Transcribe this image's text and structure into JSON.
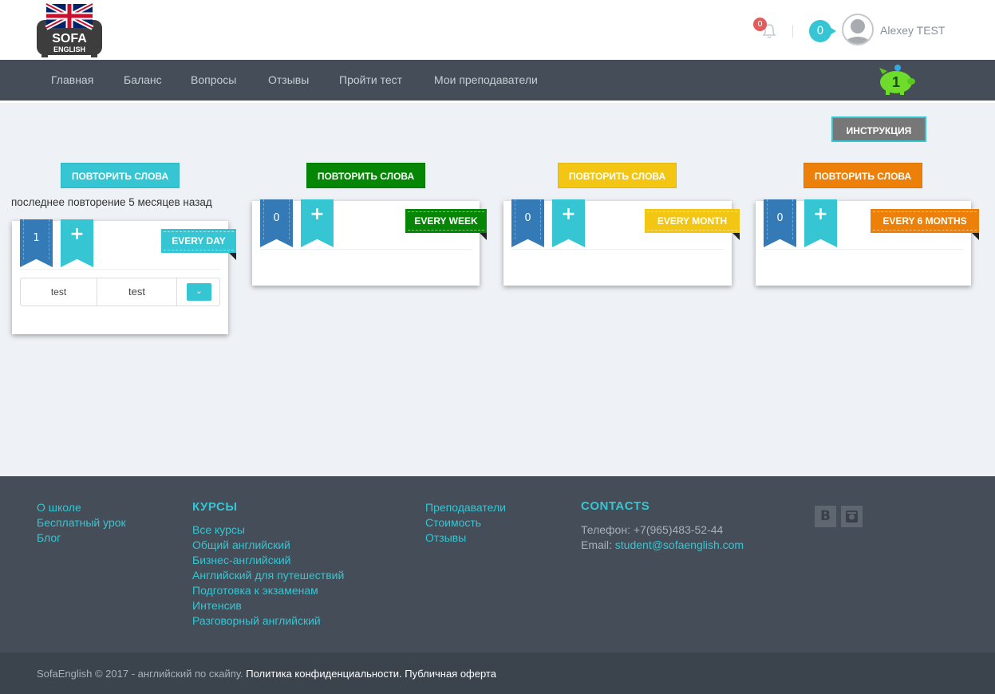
{
  "header": {
    "logo_text_top": "SOFA",
    "logo_text_bottom": "ENGLISH",
    "notifications_count": "0",
    "messages_count": "0",
    "username": "Alexey TEST"
  },
  "nav": {
    "items": [
      {
        "label": "Главная"
      },
      {
        "label": "Баланс"
      },
      {
        "label": "Вопросы"
      },
      {
        "label": "Отзывы"
      },
      {
        "label": "Пройти тест"
      },
      {
        "label": "Мои преподаватели"
      }
    ],
    "piggy_value": "1"
  },
  "main": {
    "instruction_label": "ИНСТРУКЦИЯ",
    "last_repeat_text": "последнее повторение 5 месяцев назад",
    "decks": [
      {
        "repeat_label": "ПОВТОРИТЬ СЛОВА",
        "count": "1",
        "plus": "+",
        "period": "EVERY DAY",
        "color": "#36c6d3",
        "words": [
          {
            "left": "test",
            "right": "test"
          }
        ]
      },
      {
        "repeat_label": "ПОВТОРИТЬ СЛОВА",
        "count": "0",
        "plus": "+",
        "period": "EVERY WEEK",
        "color": "#058705"
      },
      {
        "repeat_label": "ПОВТОРИТЬ СЛОВА",
        "count": "0",
        "plus": "+",
        "period": "EVERY MONTH",
        "color": "#f2c613"
      },
      {
        "repeat_label": "ПОВТОРИТЬ СЛОВА",
        "count": "0",
        "plus": "+",
        "period": "EVERY 6 MONTHS",
        "color": "#ec8008"
      }
    ]
  },
  "footer": {
    "col1": [
      "О школе",
      "Бесплатный урок",
      "Блог"
    ],
    "courses_heading": "КУРСЫ",
    "courses": [
      "Все курсы",
      "Общий английский",
      "Бизнес-английский",
      "Английский для путешествий",
      "Подготовка к экзаменам",
      "Интенсив",
      "Разговорный английский"
    ],
    "col3": [
      "Преподаватели",
      "Стоимость",
      "Отзывы"
    ],
    "contacts_heading": "CONTACTS",
    "phone": "Телефон: +7(965)483-52-44",
    "email_label": "Email: ",
    "email": "student@sofaenglish.com",
    "social": [
      {
        "icon": "vk-icon",
        "glyph": "B"
      },
      {
        "icon": "instagram-icon",
        "glyph": "◙"
      }
    ],
    "copyright": "SofaEnglish © 2017 - английский по скайпу. ",
    "privacy_link": "Политика конфиденциальности",
    "sep": ". ",
    "offer_link": "Публичная оферта"
  },
  "colors": {
    "accent": "#36c6d3",
    "nav_bg": "#444d58",
    "ribbon_dark": "#337ab7",
    "body_bg": "#eef1f5"
  }
}
